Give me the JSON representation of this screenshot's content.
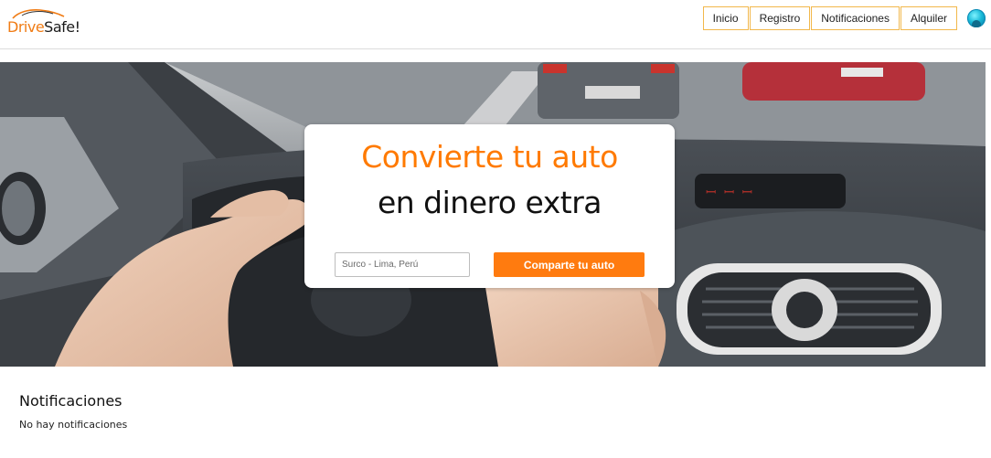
{
  "brand": {
    "drive": "Drive",
    "safe": "Safe!",
    "accent": "#ff7a00"
  },
  "nav": {
    "items": [
      {
        "label": "Inicio"
      },
      {
        "label": "Registro"
      },
      {
        "label": "Notificaciones"
      },
      {
        "label": "Alquiler"
      }
    ],
    "border_color": "#f2b84b",
    "avatar_icon": "user-avatar-icon"
  },
  "hero": {
    "headline_line1": "Convierte tu auto",
    "headline_line2": "en dinero extra",
    "location_value": "Surco - Lima, Perú",
    "cta_label": "Comparte tu auto",
    "cta_color": "#ff7b0f"
  },
  "notifications": {
    "title": "Notificaciones",
    "empty_text": "No hay notificaciones"
  }
}
